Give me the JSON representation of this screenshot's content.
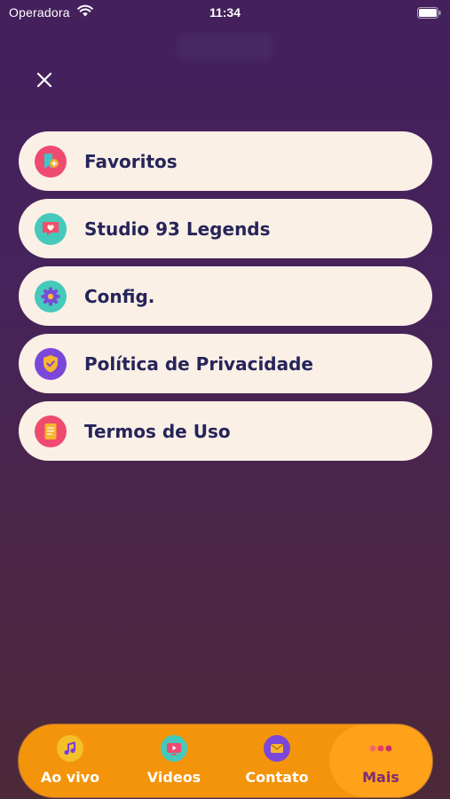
{
  "status_bar": {
    "carrier": "Operadora",
    "time": "11:34"
  },
  "menu": {
    "items": [
      {
        "label": "Favoritos",
        "icon": "bookmark-icon"
      },
      {
        "label": "Studio 93 Legends",
        "icon": "heart-chat-icon"
      },
      {
        "label": "Config.",
        "icon": "gear-icon"
      },
      {
        "label": "Política de Privacidade",
        "icon": "shield-icon"
      },
      {
        "label": "Termos de Uso",
        "icon": "document-icon"
      }
    ]
  },
  "tabs": [
    {
      "label": "Ao vivo",
      "icon": "music-note-icon",
      "active": false
    },
    {
      "label": "Videos",
      "icon": "video-player-icon",
      "active": false
    },
    {
      "label": "Contato",
      "icon": "envelope-icon",
      "active": false
    },
    {
      "label": "Mais",
      "icon": "more-dots-icon",
      "active": true
    }
  ],
  "colors": {
    "card_background": "#faf0e6",
    "card_text": "#26245a",
    "tab_bar": "#f4940a",
    "tab_active": "#ffa119",
    "tab_active_text": "#7d2c74"
  }
}
